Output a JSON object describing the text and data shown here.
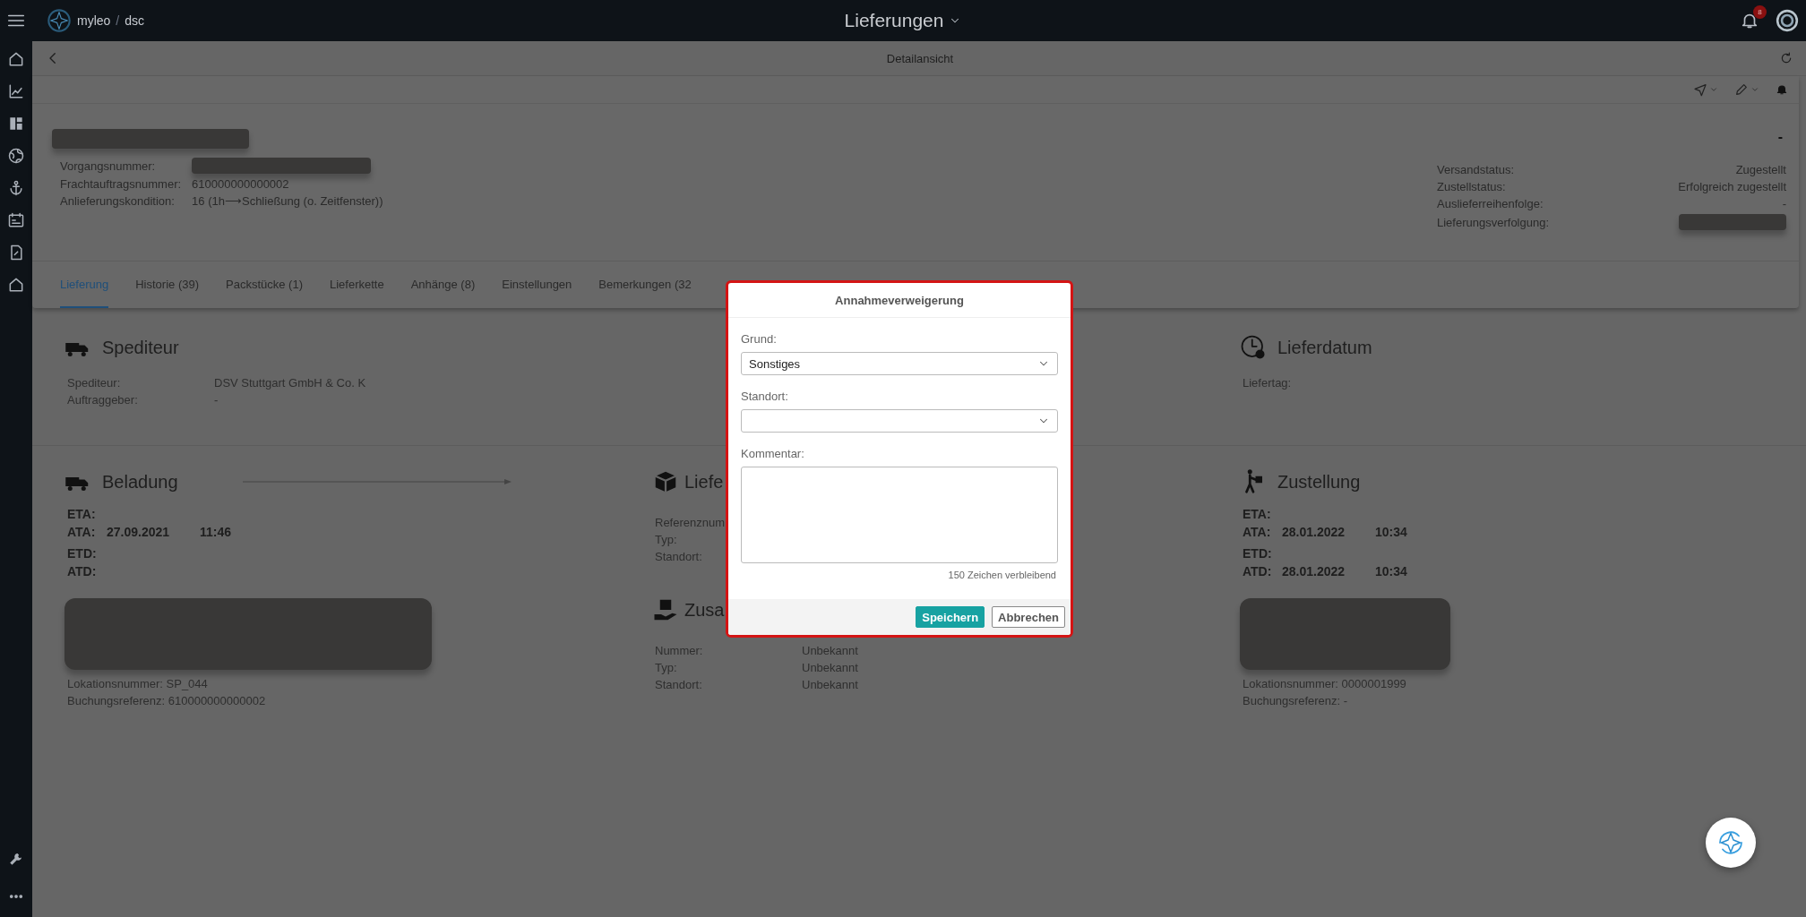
{
  "app": {
    "logo_name": "myleo",
    "logo_separator": "/",
    "logo_suffix": "dsc",
    "title": "Lieferungen",
    "notification_count": "8"
  },
  "page": {
    "title": "Detailansicht"
  },
  "header": {
    "status_mark": "-",
    "fields": [
      {
        "label": "Vorgangsnummer:",
        "kind": "redacted"
      },
      {
        "label": "Frachtauftragsnummer:",
        "kind": "text",
        "value": "610000000000002"
      },
      {
        "label": "Anlieferungskondition:",
        "kind": "text",
        "value": "16 (1h⟶Schließung (o. Zeitfenster))"
      }
    ],
    "status_fields": [
      {
        "label": "Versandstatus:",
        "kind": "text",
        "value": "Zugestellt"
      },
      {
        "label": "Zustellstatus:",
        "kind": "text",
        "value": "Erfolgreich zugestellt"
      },
      {
        "label": "Auslieferreihenfolge:",
        "kind": "text",
        "value": "-"
      },
      {
        "label": "Lieferungsverfolgung:",
        "kind": "redacted"
      }
    ]
  },
  "tabs": [
    {
      "label": "Lieferung",
      "selected": true
    },
    {
      "label": "Historie (39)",
      "selected": false
    },
    {
      "label": "Packstücke (1)",
      "selected": false
    },
    {
      "label": "Lieferkette",
      "selected": false
    },
    {
      "label": "Anhänge (8)",
      "selected": false
    },
    {
      "label": "Einstellungen",
      "selected": false
    },
    {
      "label": "Bemerkungen (32",
      "selected": false
    }
  ],
  "carrier_section": {
    "title": "Spediteur",
    "rows": [
      {
        "label": "Spediteur:",
        "value": "DSV Stuttgart GmbH & Co. K"
      },
      {
        "label": "Auftraggeber:",
        "value": "-"
      }
    ]
  },
  "delivery_date_section": {
    "title": "Lieferdatum",
    "rows": [
      {
        "label": "Liefertag:"
      }
    ]
  },
  "loading_section": {
    "title": "Beladung",
    "times": [
      [
        {
          "label": "ETA:"
        },
        {
          "label": "ATA:",
          "date": "27.09.2021",
          "time": "11:46"
        }
      ],
      [
        {
          "label": "ETD:"
        },
        {
          "label": "ATD:"
        }
      ]
    ],
    "location": "Lokationsnummer: SP_044",
    "booking": "Buchungsreferenz: 610000000000002"
  },
  "middle_sections": [
    {
      "title": "Liefe",
      "rows": [
        {
          "label": "Referenznum"
        },
        {
          "label": "Typ:"
        },
        {
          "label": "Standort:"
        }
      ]
    },
    {
      "title": "Zusa",
      "rows": [
        {
          "label": "Nummer:",
          "value": "Unbekannt"
        },
        {
          "label": "Typ:",
          "value": "Unbekannt"
        },
        {
          "label": "Standort:",
          "value": "Unbekannt"
        }
      ]
    }
  ],
  "delivery_section": {
    "title": "Zustellung",
    "times": [
      [
        {
          "label": "ETA:"
        },
        {
          "label": "ATA:",
          "date": "28.01.2022",
          "time": "10:34"
        }
      ],
      [
        {
          "label": "ETD:"
        },
        {
          "label": "ATD:",
          "date": "28.01.2022",
          "time": "10:34"
        }
      ]
    ],
    "location": "Lokationsnummer: 0000001999",
    "booking": "Buchungsreferenz: -"
  },
  "dialog": {
    "title": "Annahmeverweigerung",
    "reason_label": "Grund:",
    "reason_value": "Sonstiges",
    "location_label": "Standort:",
    "comment_label": "Kommentar:",
    "remaining": "150 Zeichen verbleibend",
    "buttons": [
      {
        "label": "Speichern",
        "kind": "primary"
      },
      {
        "label": "Abbrechen",
        "kind": "secondary"
      }
    ]
  }
}
